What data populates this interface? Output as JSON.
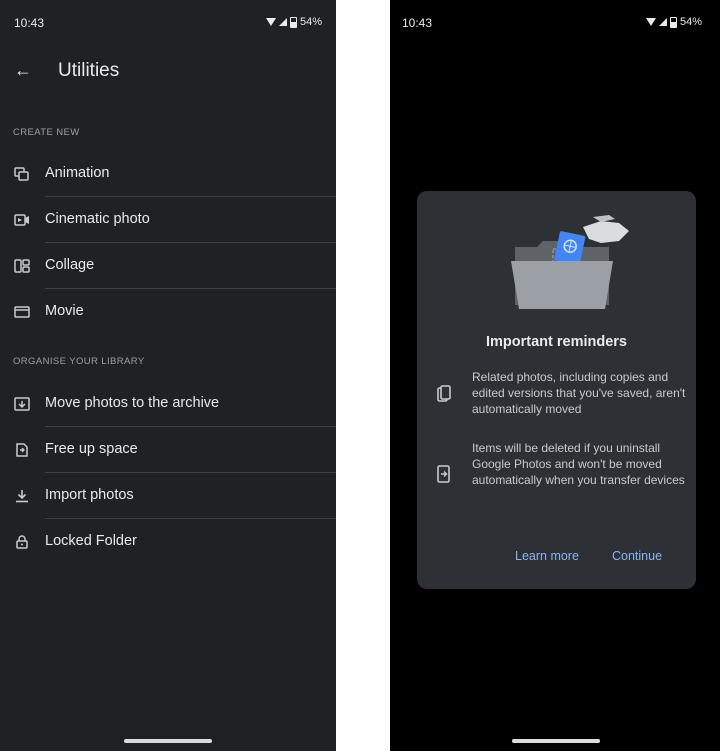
{
  "left_screen": {
    "status": {
      "time": "10:43",
      "battery": "54%"
    },
    "title": "Utilities",
    "sections": [
      {
        "header": "CREATE NEW",
        "items": [
          {
            "label": "Animation",
            "icon": "animation-icon"
          },
          {
            "label": "Cinematic photo",
            "icon": "cinematic-photo-icon"
          },
          {
            "label": "Collage",
            "icon": "collage-icon"
          },
          {
            "label": "Movie",
            "icon": "movie-icon"
          }
        ]
      },
      {
        "header": "ORGANISE YOUR LIBRARY",
        "items": [
          {
            "label": "Move photos to the archive",
            "icon": "archive-icon"
          },
          {
            "label": "Free up space",
            "icon": "free-up-space-icon"
          },
          {
            "label": "Import photos",
            "icon": "download-icon"
          },
          {
            "label": "Locked Folder",
            "icon": "lock-icon"
          }
        ]
      }
    ]
  },
  "right_screen": {
    "status": {
      "time": "10:43",
      "battery": "54%"
    },
    "dialog": {
      "title": "Important reminders",
      "reminders": [
        {
          "text": "Related photos, including copies and edited versions that you've saved, aren't automatically moved",
          "icon": "copies-icon"
        },
        {
          "text": "Items will be deleted if you uninstall Google Photos and won't be moved automatically when you transfer devices",
          "icon": "transfer-device-icon"
        }
      ],
      "learn_more": "Learn more",
      "continue": "Continue"
    }
  },
  "colors": {
    "left_bg": "#1f2124",
    "right_bg": "#000000",
    "dialog_bg": "#2d3034",
    "accent": "#8ab4f8"
  }
}
